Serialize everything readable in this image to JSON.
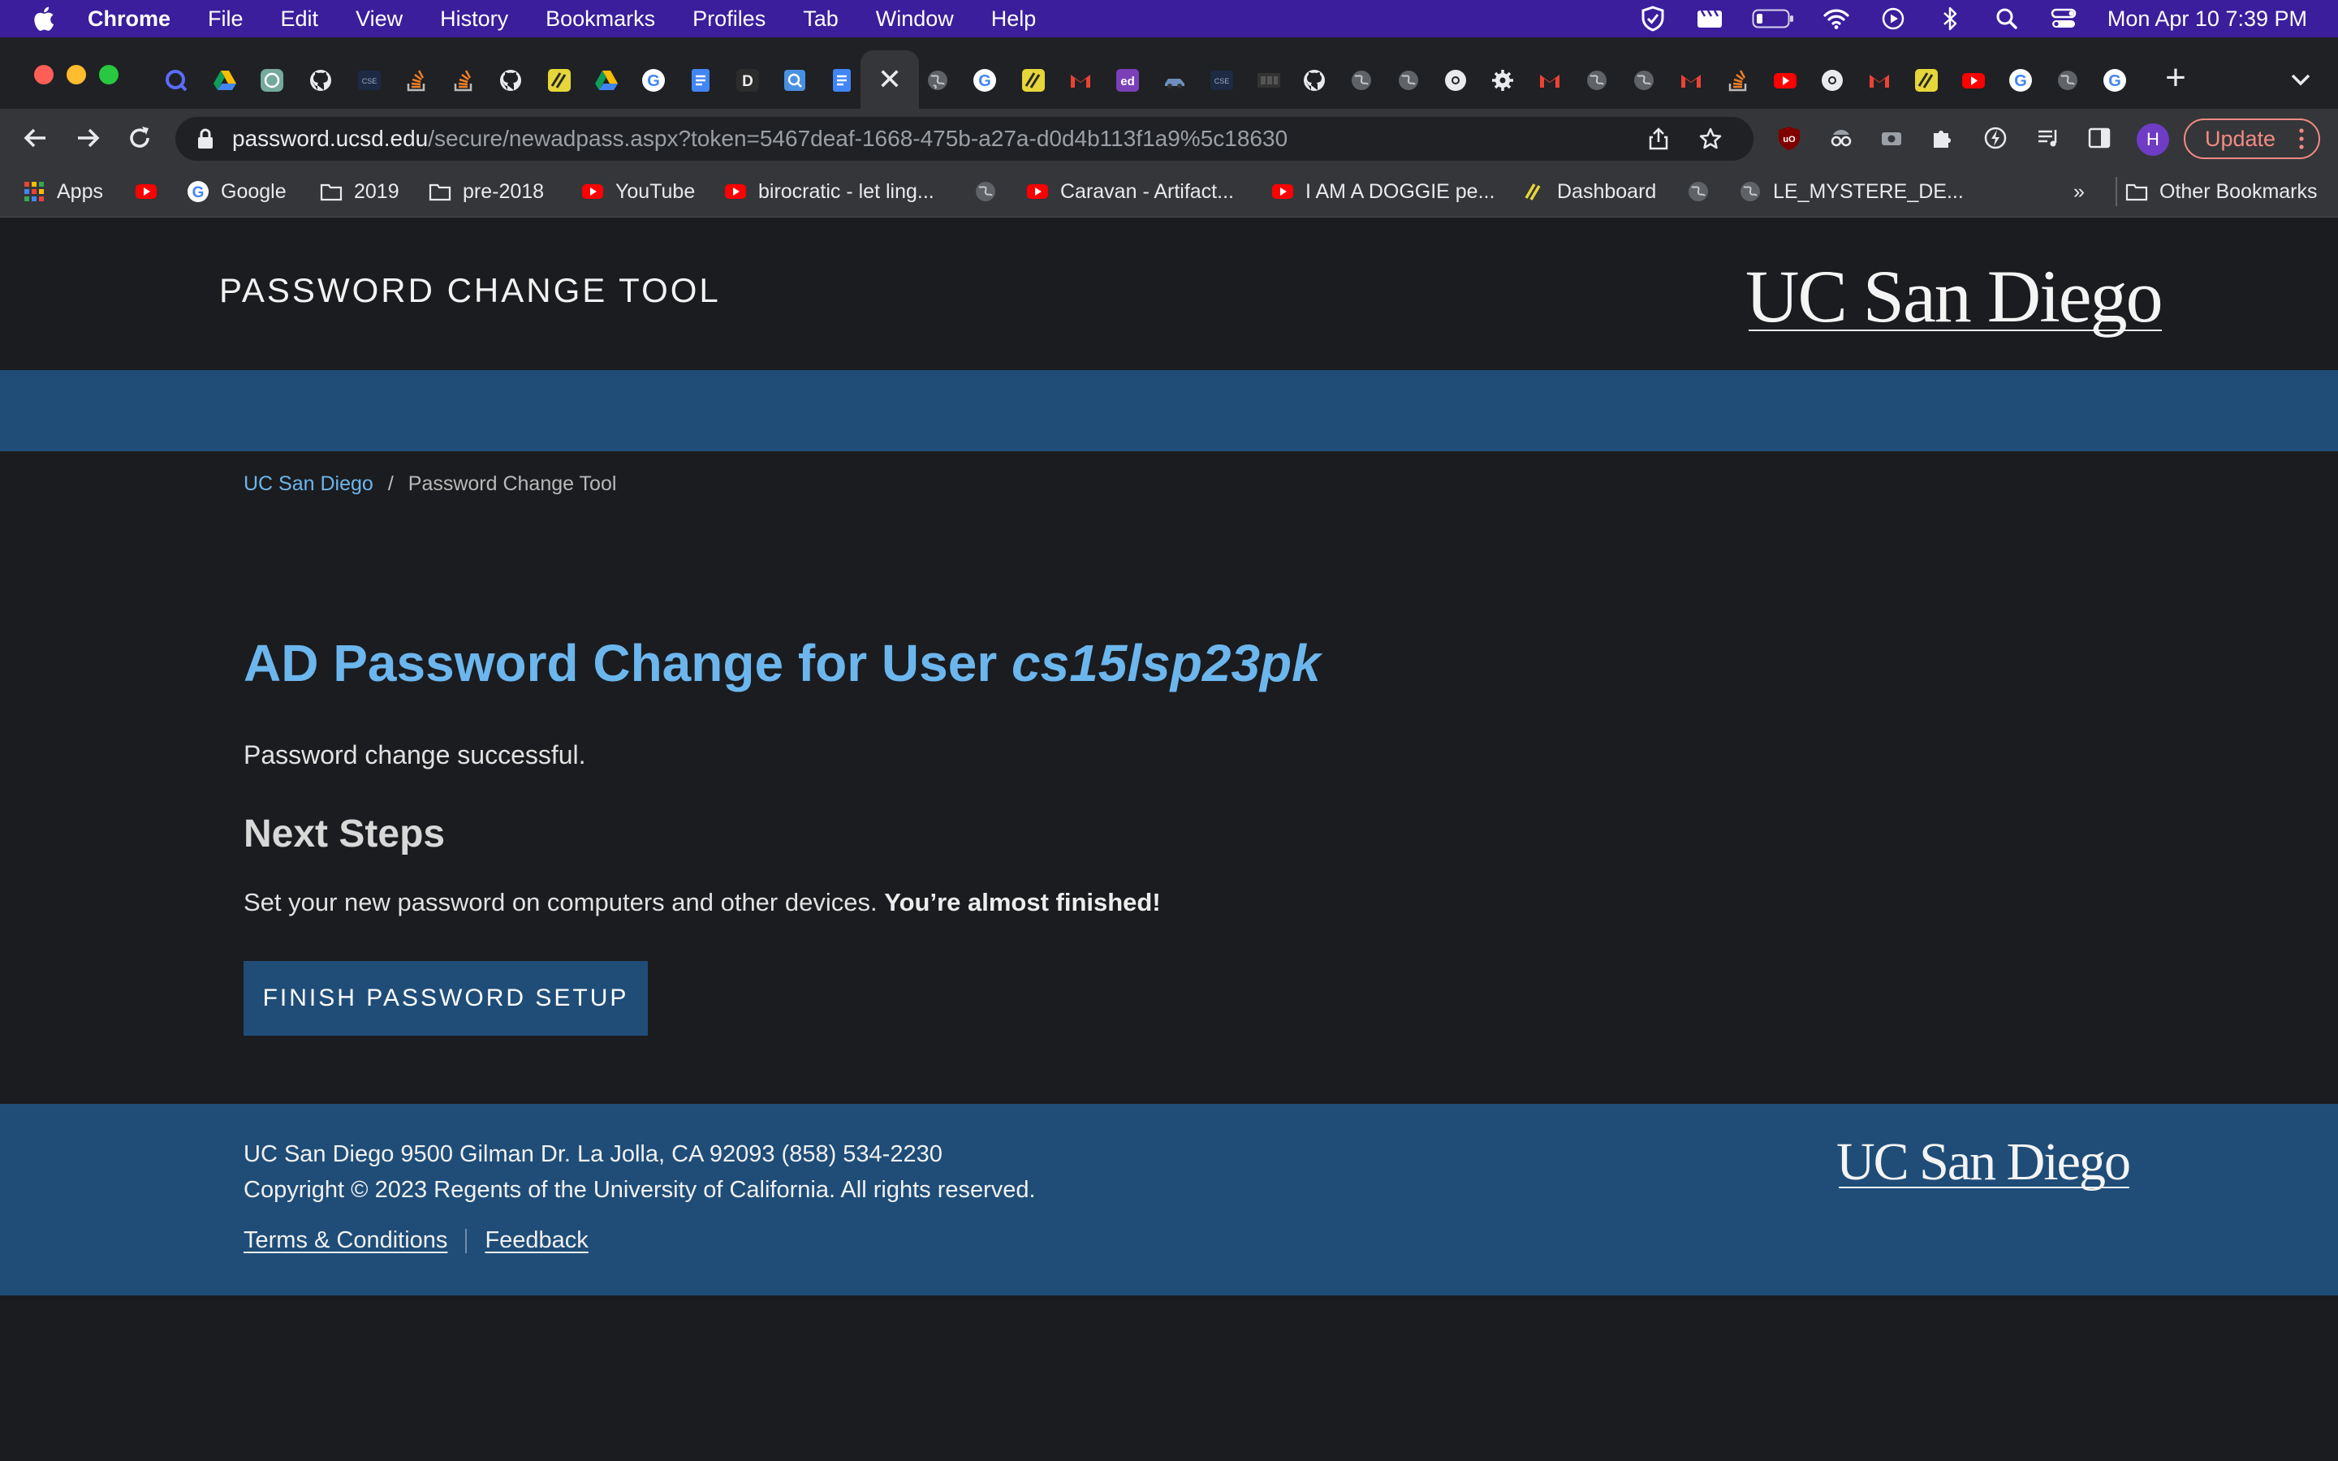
{
  "menubar": {
    "app_name": "Chrome",
    "items": [
      "File",
      "Edit",
      "View",
      "History",
      "Bookmarks",
      "Profiles",
      "Tab",
      "Window",
      "Help"
    ],
    "clock": "Mon Apr 10  7:39 PM"
  },
  "browser": {
    "url_host": "password.ucsd.edu",
    "url_path": "/secure/newadpass.aspx?token=5467deaf-1668-475b-a27a-d0d4b113f1a9%5c18630",
    "avatar_initial": "H",
    "update_label": "Update",
    "active_tab_close": "✕",
    "new_tab": "+"
  },
  "bookmarks": {
    "apps": "Apps",
    "google": "Google",
    "folder_2019": "2019",
    "folder_pre2018": "pre-2018",
    "youtube": "YouTube",
    "birocratic": "birocratic - let ling...",
    "caravan": "Caravan - Artifact...",
    "doggie": "I AM A DOGGIE pe...",
    "dashboard": "Dashboard",
    "mystere": "LE_MYSTERE_DE...",
    "overflow": "»",
    "other": "Other Bookmarks"
  },
  "page": {
    "site_title": "PASSWORD CHANGE TOOL",
    "logo_text": "UC San Diego",
    "breadcrumb": {
      "home": "UC San Diego",
      "separator": "/",
      "current": "Password Change Tool"
    },
    "heading_prefix": "AD Password Change for User ",
    "heading_user": "cs15lsp23pk",
    "status": "Password change successful.",
    "next_heading": "Next Steps",
    "next_text": "Set your new password on computers and other devices. ",
    "next_text_strong": "You’re almost finished!",
    "finish_button": "FINISH PASSWORD SETUP"
  },
  "footer": {
    "address": "UC San Diego 9500 Gilman Dr. La Jolla, CA 92093 (858) 534-2230",
    "copyright": "Copyright © 2023 Regents of the University of California. All rights reserved.",
    "terms": "Terms & Conditions",
    "feedback": "Feedback",
    "logo_text": "UC San Diego"
  },
  "colors": {
    "menubar_bg": "#3a1e9c",
    "page_bg": "#1b1c1f",
    "ucsd_blue": "#1f4d78",
    "link_blue": "#6cb6ee"
  }
}
